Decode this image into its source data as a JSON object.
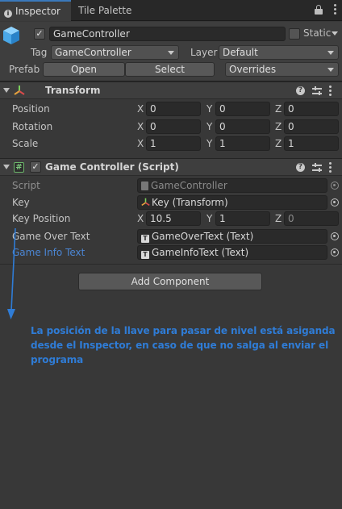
{
  "tabs": [
    {
      "label": "Inspector",
      "active": true
    },
    {
      "label": "Tile Palette",
      "active": false
    }
  ],
  "gameobject": {
    "active_check": "✓",
    "name": "GameController",
    "static_label": "Static",
    "tag_label": "Tag",
    "tag_value": "GameController",
    "layer_label": "Layer",
    "layer_value": "Default",
    "prefab_label": "Prefab",
    "open_label": "Open",
    "select_label": "Select",
    "overrides_label": "Overrides"
  },
  "transform": {
    "title": "Transform",
    "rows": [
      {
        "label": "Position",
        "x": "0",
        "y": "0",
        "z": "0"
      },
      {
        "label": "Rotation",
        "x": "0",
        "y": "0",
        "z": "0"
      },
      {
        "label": "Scale",
        "x": "1",
        "y": "1",
        "z": "1"
      }
    ],
    "axes": [
      "X",
      "Y",
      "Z"
    ]
  },
  "script_component": {
    "title": "Game Controller (Script)",
    "enabled_check": "✓",
    "script_label": "Script",
    "script_value": "GameController",
    "key_label": "Key",
    "key_value": "Key (Transform)",
    "key_position_label": "Key Position",
    "key_position": {
      "x": "10.5",
      "y": "1",
      "z": "0"
    },
    "game_over_label": "Game Over Text",
    "game_over_value": "GameOverText (Text)",
    "game_info_label": "Game Info Text",
    "game_info_value": "GameInfoText (Text)"
  },
  "add_component_label": "Add Component",
  "annotation": {
    "text": "La posición de la llave para pasar de nivel está asiganda desde el Inspector, en caso de que no salga al enviar el programa",
    "color": "#2f7cd6"
  },
  "colors": {
    "background": "#383838",
    "accent": "#3a79bb",
    "field": "#2a2a2a"
  }
}
